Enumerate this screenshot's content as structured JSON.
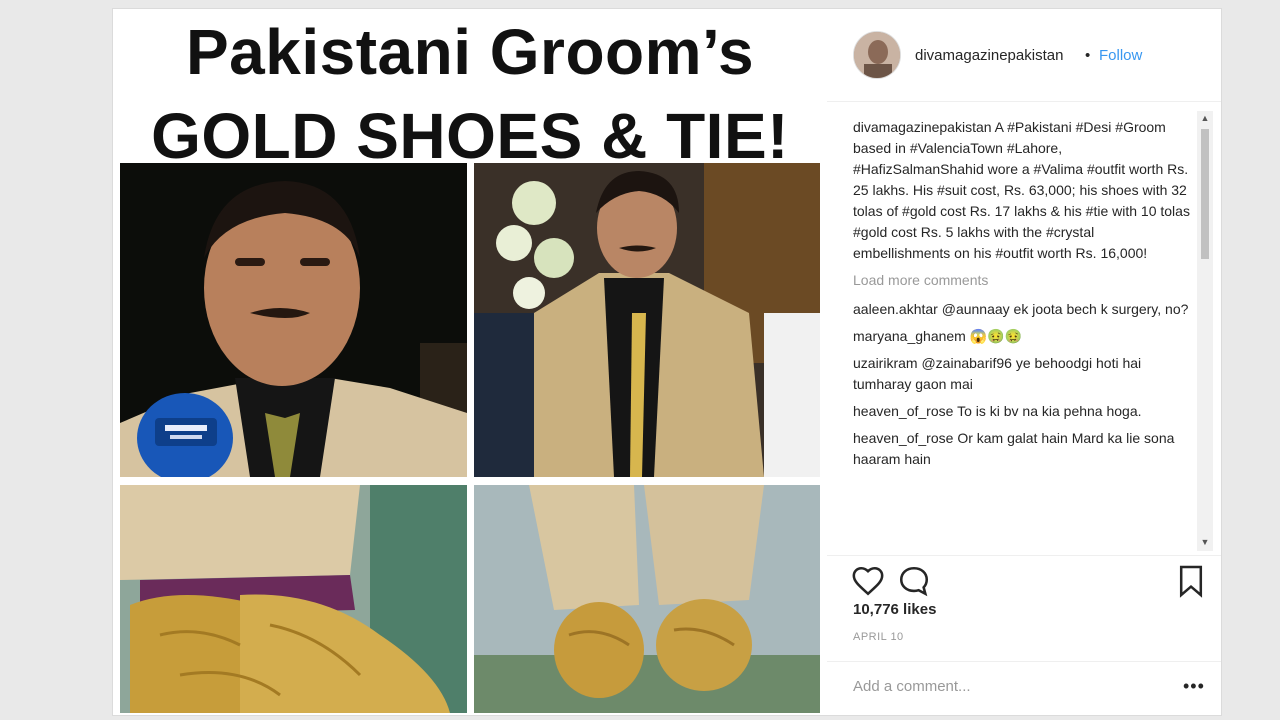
{
  "post": {
    "headline_line1": "Pakistani Groom’s",
    "headline_line2": "GOLD SHOES & TIE!"
  },
  "header": {
    "username": "divamagazinepakistan",
    "separator": "•",
    "follow_label": "Follow"
  },
  "caption": {
    "username": "divamagazinepakistan",
    "text": "A #Pakistani #Desi #Groom based in #ValenciaTown #Lahore, #HafizSalmanShahid wore a #Valima #outfit worth Rs. 25 lakhs. His #suit cost, Rs. 63,000; his shoes with 32 tolas of #gold cost Rs. 17 lakhs & his #tie with 10 tolas #gold cost Rs. 5 lakhs with the #crystal embellishments on his #outfit worth Rs. 16,000!"
  },
  "load_more": "Load more comments",
  "comments": [
    {
      "user": "aaleen.akhtar",
      "text": "@aunnaay ek joota bech k surgery, no?"
    },
    {
      "user": "maryana_ghanem",
      "text": "😱🤢🤢"
    },
    {
      "user": "uzairikram",
      "text": "@zainabarif96 ye behoodgi hoti hai tumharay gaon mai"
    },
    {
      "user": "heaven_of_rose",
      "text": "To is ki bv na kia pehna hoga."
    },
    {
      "user": "heaven_of_rose",
      "text": "Or kam galat hain Mard ka lie sona haaram hain"
    }
  ],
  "actions": {
    "like_icon": "heart-icon",
    "comment_icon": "comment-bubble-icon",
    "save_icon": "bookmark-icon"
  },
  "likes": "10,776 likes",
  "date": "APRIL 10",
  "add_comment_placeholder": "Add a comment...",
  "more_options": "•••",
  "colors": {
    "link": "#3897f0",
    "text": "#262626",
    "muted": "#999999",
    "gold": "#c9a13a"
  }
}
